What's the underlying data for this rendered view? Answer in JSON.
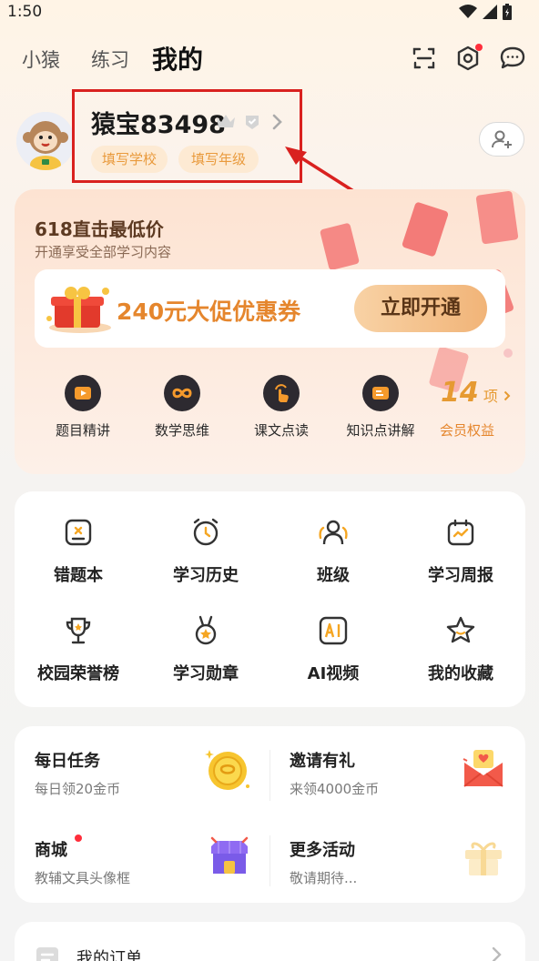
{
  "status": {
    "time": "1:50"
  },
  "nav": {
    "tabs": [
      {
        "label": "小猿",
        "active": false
      },
      {
        "label": "练习",
        "active": false
      },
      {
        "label": "我的",
        "active": true
      }
    ],
    "icons": [
      "scan-icon",
      "settings-icon",
      "message-icon"
    ]
  },
  "profile": {
    "username": "猿宝83498",
    "tags": [
      "填写学校",
      "填写年级"
    ]
  },
  "promo": {
    "title": "618直击最低价",
    "subtitle": "开通享受全部学习内容",
    "coupon_text": "240元大促优惠券",
    "coupon_button": "立即开通",
    "benefits": [
      {
        "label": "题目精讲",
        "icon": "play-icon"
      },
      {
        "label": "数学思维",
        "icon": "infinity-icon"
      },
      {
        "label": "课文点读",
        "icon": "tap-icon"
      },
      {
        "label": "知识点讲解",
        "icon": "book-icon"
      }
    ],
    "benefit_count": "14",
    "benefit_unit": "项",
    "benefit_label": "会员权益"
  },
  "tools": [
    {
      "label": "错题本",
      "icon": "mistake-book-icon"
    },
    {
      "label": "学习历史",
      "icon": "clock-icon"
    },
    {
      "label": "班级",
      "icon": "class-icon"
    },
    {
      "label": "学习周报",
      "icon": "calendar-icon"
    },
    {
      "label": "校园荣誉榜",
      "icon": "trophy-icon"
    },
    {
      "label": "学习勋章",
      "icon": "medal-icon"
    },
    {
      "label": "AI视频",
      "icon": "ai-icon"
    },
    {
      "label": "我的收藏",
      "icon": "star-icon"
    }
  ],
  "activities": [
    {
      "title": "每日任务",
      "subtitle": "每日领20金币",
      "icon": "coin-icon"
    },
    {
      "title": "邀请有礼",
      "subtitle": "来领4000金币",
      "icon": "envelope-icon"
    },
    {
      "title": "商城",
      "subtitle": "教辅文具头像框",
      "icon": "shop-icon"
    },
    {
      "title": "更多活动",
      "subtitle": "敬请期待...",
      "icon": "gift-icon"
    }
  ],
  "orders": {
    "label": "我的订单"
  },
  "colors": {
    "accent": "#e5862d",
    "annotation": "#d9211f"
  }
}
